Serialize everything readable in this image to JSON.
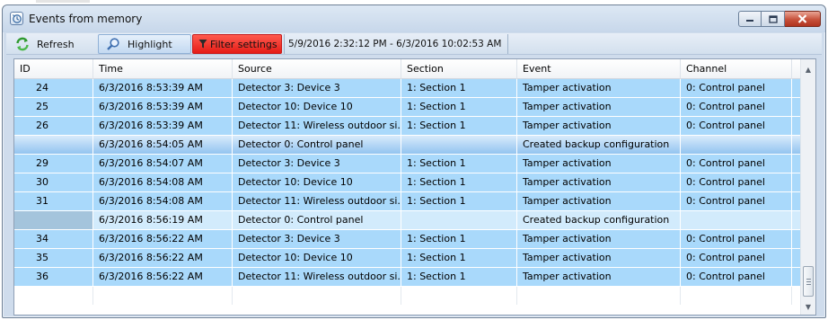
{
  "window": {
    "title": "Events from memory",
    "controls": {
      "minimize": "minimize",
      "maximize": "maximize",
      "close": "close"
    }
  },
  "toolbar": {
    "refresh_label": "Refresh",
    "highlight_label": "Highlight",
    "filter_label": "Filter settings",
    "date_range": "5/9/2016 2:32:12 PM - 6/3/2016 10:02:53 AM"
  },
  "table": {
    "columns": [
      "ID",
      "Time",
      "Source",
      "Section",
      "Event",
      "Channel"
    ],
    "rows": [
      {
        "id": "24",
        "time": "6/3/2016 8:53:39 AM",
        "source": "Detector 3: Device 3",
        "section": "1: Section 1",
        "event": "Tamper activation",
        "channel": "0: Control panel"
      },
      {
        "id": "25",
        "time": "6/3/2016 8:53:39 AM",
        "source": "Detector 10: Device 10",
        "section": "1: Section 1",
        "event": "Tamper activation",
        "channel": "0: Control panel"
      },
      {
        "id": "26",
        "time": "6/3/2016 8:53:39 AM",
        "source": "Detector 11: Wireless outdoor si...",
        "section": "1: Section 1",
        "event": "Tamper activation",
        "channel": "0: Control panel"
      },
      {
        "id": "",
        "time": "6/3/2016 8:54:05 AM",
        "source": "Detector 0: Control panel",
        "section": "",
        "event": "Created backup configuration",
        "channel": ""
      },
      {
        "id": "29",
        "time": "6/3/2016 8:54:07 AM",
        "source": "Detector 3: Device 3",
        "section": "1: Section 1",
        "event": "Tamper activation",
        "channel": "0: Control panel"
      },
      {
        "id": "30",
        "time": "6/3/2016 8:54:08 AM",
        "source": "Detector 10: Device 10",
        "section": "1: Section 1",
        "event": "Tamper activation",
        "channel": "0: Control panel"
      },
      {
        "id": "31",
        "time": "6/3/2016 8:54:08 AM",
        "source": "Detector 11: Wireless outdoor si...",
        "section": "1: Section 1",
        "event": "Tamper activation",
        "channel": "0: Control panel"
      },
      {
        "id": "",
        "time": "6/3/2016 8:56:19 AM",
        "source": "Detector 0: Control panel",
        "section": "",
        "event": "Created backup configuration",
        "channel": ""
      },
      {
        "id": "34",
        "time": "6/3/2016 8:56:22 AM",
        "source": "Detector 3: Device 3",
        "section": "1: Section 1",
        "event": "Tamper activation",
        "channel": "0: Control panel"
      },
      {
        "id": "35",
        "time": "6/3/2016 8:56:22 AM",
        "source": "Detector 10: Device 10",
        "section": "1: Section 1",
        "event": "Tamper activation",
        "channel": "0: Control panel"
      },
      {
        "id": "36",
        "time": "6/3/2016 8:56:22 AM",
        "source": "Detector 11: Wireless outdoor si...",
        "section": "1: Section 1",
        "event": "Tamper activation",
        "channel": "0: Control panel"
      }
    ],
    "selected_row": 3
  },
  "colors": {
    "row_background": "#a9d9fb",
    "filter_button": "#e51c16",
    "highlight_button": "#c3d9f1",
    "close_button": "#c7513a"
  },
  "icons": {
    "window": "events-window-icon",
    "refresh": "refresh-arrows-icon",
    "highlight": "magnifier-icon",
    "filter": "funnel-icon"
  }
}
